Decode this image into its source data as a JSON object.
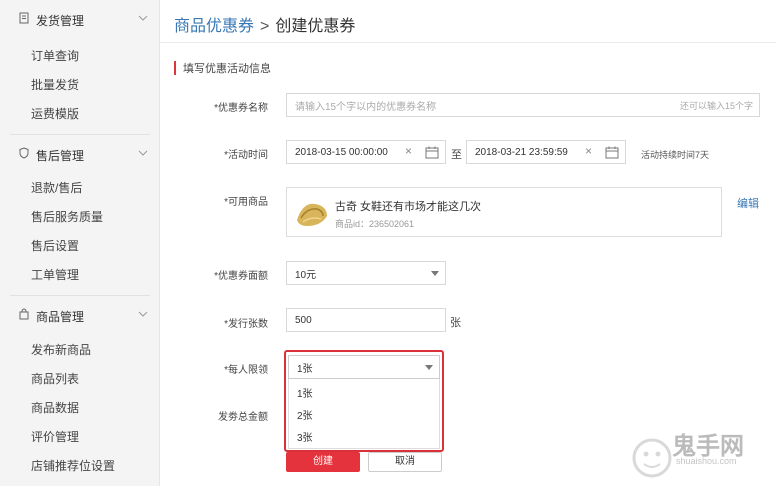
{
  "sidebar": {
    "groups": [
      {
        "title": "发货管理",
        "icon": "document-icon",
        "items": [
          "订单查询",
          "批量发货",
          "运费模版"
        ]
      },
      {
        "title": "售后管理",
        "icon": "shield-icon",
        "items": [
          "退款/售后",
          "售后服务质量",
          "售后设置",
          "工单管理"
        ]
      },
      {
        "title": "商品管理",
        "icon": "bag-icon",
        "items": [
          "发布新商品",
          "商品列表",
          "商品数据",
          "评价管理",
          "店铺推荐位设置"
        ]
      }
    ]
  },
  "breadcrumb": {
    "parent": "商品优惠券",
    "separator": ">",
    "current": "创建优惠券"
  },
  "section_title": "填写优惠活动信息",
  "form": {
    "name": {
      "label": "*优惠券名称",
      "placeholder": "请输入15个字以内的优惠券名称",
      "hint": "还可以输入15个字"
    },
    "time": {
      "label": "*活动时间",
      "start": "2018-03-15 00:00:00",
      "to": "至",
      "end": "2018-03-21 23:59:59",
      "duration": "活动持续时间7天"
    },
    "product": {
      "label": "*可用商品",
      "name": "古奇 女鞋还有市场才能这几次",
      "id": "商品id：236502061",
      "edit": "编辑"
    },
    "amount": {
      "label": "*优惠券面额",
      "value": "10元"
    },
    "count": {
      "label": "*发行张数",
      "value": "500",
      "unit": "张"
    },
    "limit": {
      "label": "*每人限领",
      "value": "1张",
      "options": [
        "1张",
        "2张",
        "3张"
      ]
    },
    "total": {
      "label": "发劵总金额"
    }
  },
  "buttons": {
    "create": "创建",
    "cancel": "取消"
  },
  "watermark": {
    "text": "鬼手网",
    "sub": "shuaishou.com"
  },
  "colors": {
    "accent": "#e5333d",
    "link": "#3a78b5"
  }
}
